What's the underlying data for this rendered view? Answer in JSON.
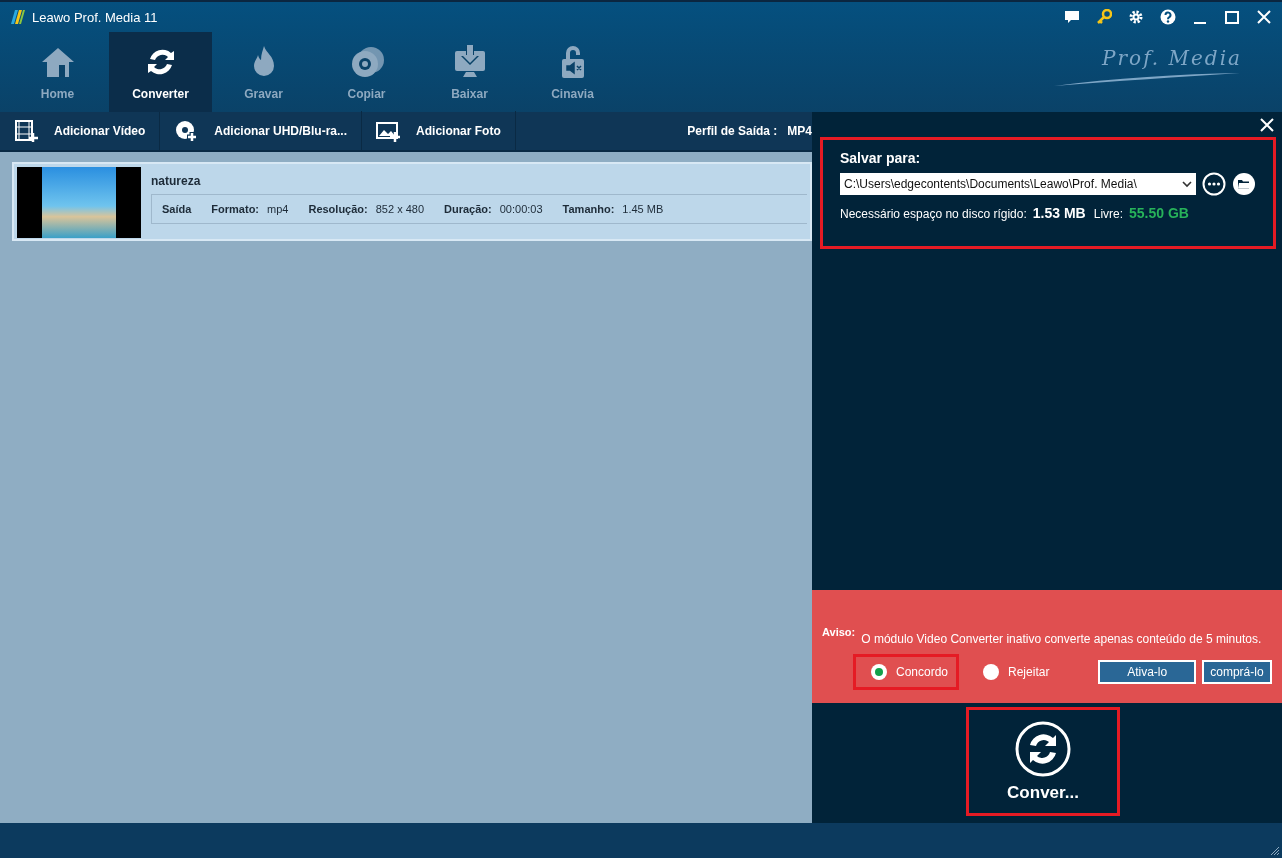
{
  "window": {
    "title": "Leawo Prof. Media 11"
  },
  "nav_tabs": [
    {
      "label": "Home",
      "kind": "home",
      "selected": false
    },
    {
      "label": "Converter",
      "kind": "convert",
      "selected": true
    },
    {
      "label": "Gravar",
      "kind": "burn",
      "selected": false
    },
    {
      "label": "Copiar",
      "kind": "copy",
      "selected": false
    },
    {
      "label": "Baixar",
      "kind": "download",
      "selected": false
    },
    {
      "label": "Cinavia",
      "kind": "unlock",
      "selected": false
    }
  ],
  "brand_logo": "Prof. Media",
  "toolbar": {
    "buttons": [
      {
        "label": "Adicionar Vídeo",
        "kind": "video"
      },
      {
        "label": "Adicionar UHD/Blu-ra...",
        "kind": "disc"
      },
      {
        "label": "Adicionar Foto",
        "kind": "photo"
      }
    ],
    "output_profile_label": "Perfil de Saída :",
    "output_profile_value": "MP4"
  },
  "files": [
    {
      "name": "natureza",
      "output_label": "Saída",
      "fields": [
        {
          "label": "Formato:",
          "value": "mp4"
        },
        {
          "label": "Resolução:",
          "value": "852 x 480"
        },
        {
          "label": "Duração:",
          "value": "00:00:03"
        },
        {
          "label": "Tamanho:",
          "value": "1.45 MB"
        }
      ]
    }
  ],
  "save_panel": {
    "title": "Salvar para:",
    "path": "C:\\Users\\edgecontents\\Documents\\Leawo\\Prof. Media\\",
    "space_label": "Necessário espaço no disco rígido:",
    "space_value": "1.53 MB",
    "free_label": "Livre:",
    "free_value": "55.50 GB",
    "highlighted": true
  },
  "notice": {
    "label": "Aviso:",
    "text": "O módulo Video Converter inativo converte apenas conteúdo de 5 minutos.",
    "options": [
      {
        "label": "Concordo",
        "selected": true,
        "highlighted": true
      },
      {
        "label": "Rejeitar",
        "selected": false,
        "highlighted": false
      }
    ],
    "buttons": [
      "Ativa-lo",
      "comprá-lo"
    ]
  },
  "convert_button": {
    "label": "Conver...",
    "highlighted": true
  }
}
